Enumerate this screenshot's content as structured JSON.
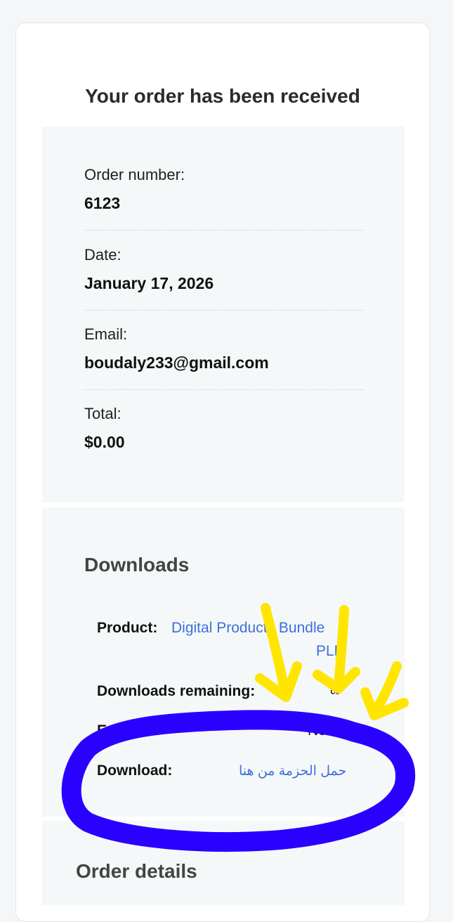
{
  "page": {
    "title": "Your order has been received"
  },
  "overview": {
    "order_number": {
      "label": "Order number:",
      "value": "6123"
    },
    "date": {
      "label": "Date:",
      "value": "January 17, 2026"
    },
    "email": {
      "label": "Email:",
      "value": "boudaly233@gmail.com"
    },
    "total": {
      "label": "Total:",
      "value": "$0.00"
    }
  },
  "downloads": {
    "title": "Downloads",
    "product_label": "Product:",
    "product_line1": "Digital Products Bundle",
    "product_line2": "PLR",
    "remaining_label": "Downloads remaining:",
    "remaining_value": "∞",
    "expires_label": "Expires:",
    "expires_value": "Never",
    "download_label": "Download:",
    "download_link": "حمل الحزمة من هنا"
  },
  "order_details": {
    "title": "Order details"
  },
  "annotations": {
    "arrow_color": "#ffe500",
    "circle_color": "#2a00ff"
  }
}
